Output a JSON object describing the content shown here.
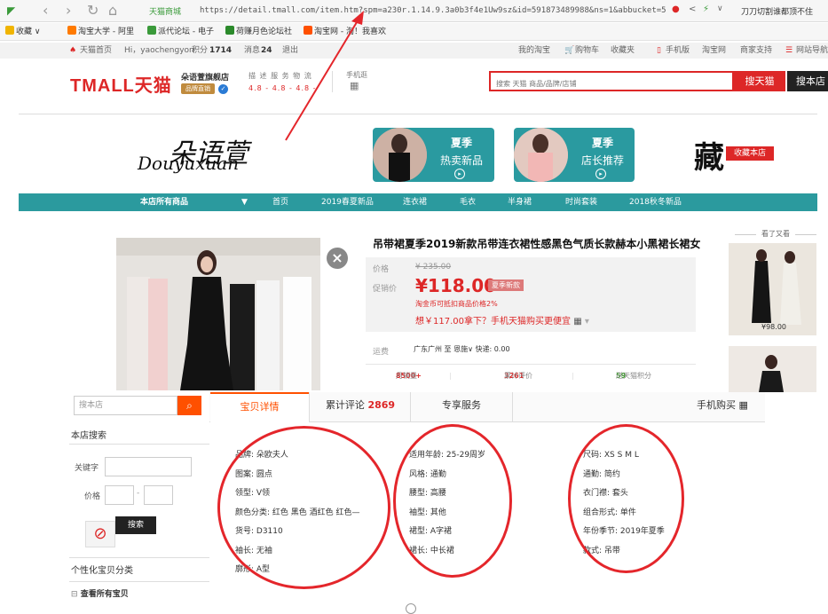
{
  "browser": {
    "url": "https://detail.tmall.com/item.htm?spm=a230r.1.14.9.3a0b3f4e1Uw9sz&id=591873489988&ns=1&abbucket=5",
    "site_label": "天猫商城",
    "right_text": "刀刀切割谁都顶不住"
  },
  "bookmarks": [
    {
      "label": "收藏",
      "color": "#f0b400"
    },
    {
      "label": "淘宝大学 - 阿里",
      "color": "#ff7a00"
    },
    {
      "label": "派代论坛 - 电子",
      "color": "#3a9a3a"
    },
    {
      "label": "荷赚月色论坛社",
      "color": "#2b8a2b"
    },
    {
      "label": "淘宝网 - 淘！我喜欢",
      "color": "#ff5000"
    }
  ],
  "topnav": {
    "home": "天猫首页",
    "greeting": "Hi，yaochengyon",
    "points_label": "积分",
    "points": "1714",
    "messages_label": "消息",
    "messages": "24",
    "logout": "退出",
    "my_taobao": "我的淘宝",
    "cart": "购物车",
    "favorites": "收藏夹",
    "mobile": "手机版",
    "taobao": "淘宝网",
    "seller": "商家支持",
    "sitenav": "网站导航"
  },
  "header": {
    "logo": "TMALL天猫",
    "shop_name": "朵语萱旗舰店",
    "shop_badge": "品牌直销",
    "ratings_label": "描 述  服 务  物 流",
    "ratings": "4.8 - 4.8 - 4.8 -",
    "mobile_label": "手机逛",
    "search_placeholder": "搜索 天猫 商品/品牌/店铺",
    "search_tmall": "搜天猫",
    "search_shop": "搜本店"
  },
  "banner": {
    "brand_cn": "朵语萱",
    "brand_en": "Douyuxuan",
    "promo1_line1": "夏季",
    "promo1_line2": "热卖新品",
    "promo2_line1": "夏季",
    "promo2_line2": "店长推荐",
    "cang": "藏",
    "fav_shop": "收藏本店"
  },
  "navbar": [
    "本店所有商品",
    "▼",
    "首页",
    "2019春夏新品",
    "连衣裙",
    "毛衣",
    "半身裙",
    "时尚套装",
    "2018秋冬新品"
  ],
  "product": {
    "title": "吊带裙夏季2019新款吊带连衣裙性感黑色气质长款赫本小黑裙长裙女",
    "price_label": "价格",
    "orig_price": "¥ 235.00",
    "promo_label": "促销价",
    "price": "¥118.00",
    "price_tag": "夏季新款",
    "coin_note": "淘金币可抵扣商品价格2%",
    "app_note": "想￥117.00拿下？手机天猫购买更便宜",
    "ship_label": "运费",
    "ship": "广东广州 至 恩施∨ 快递: 0.00",
    "sales_label": "月销量",
    "sales": "8500+",
    "reviews_label": "累计评价",
    "reviews": "3261",
    "points_label": "送天猫积分",
    "points": "59"
  },
  "side": {
    "heading": "看了又看",
    "price1": "¥98.00"
  },
  "store_panel": {
    "search_placeholder": "搜本店",
    "heading": "本店搜索",
    "keyword_label": "关键字",
    "price_label": "价格",
    "dash": "-",
    "search_button": "搜索",
    "category_heading": "个性化宝贝分类",
    "all_items": "查看所有宝贝"
  },
  "tabs": {
    "details": "宝贝详情",
    "reviews_label": "累计评论",
    "reviews_count": "2869",
    "service": "专享服务",
    "mobile": "手机购买"
  },
  "attributes": {
    "col1": [
      "品牌: 朵欧夫人",
      "图案: 圆点",
      "领型: V领",
      "颜色分类: 红色 黑色 酒红色 红色—",
      "货号: D3110",
      "袖长: 无袖",
      "廓形: A型"
    ],
    "col2": [
      "适用年龄: 25-29周岁",
      "风格: 通勤",
      "腰型: 高腰",
      "袖型: 其他",
      "裙型: A字裙",
      "裙长: 中长裙"
    ],
    "col3": [
      "尺码: XS S M L",
      "通勤: 简约",
      "衣门襟: 套头",
      "组合形式: 单件",
      "年份季节: 2019年夏季",
      "款式: 吊带"
    ]
  },
  "colors": {
    "tmall_red": "#dd2727",
    "teal": "#2b9a9e",
    "taobao_orange": "#ff5000"
  }
}
